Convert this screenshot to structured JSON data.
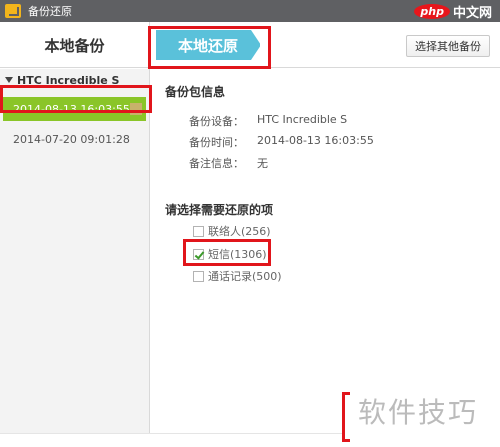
{
  "window": {
    "title": "备份还原"
  },
  "brand": {
    "php": "php",
    "cn": "中文网"
  },
  "header": {
    "left_title": "本地备份",
    "active_tab": "本地还原",
    "select_other_button": "选择其他备份"
  },
  "sidebar": {
    "device": "HTC Incredible S",
    "backups": [
      {
        "label": "2014-08-13 16:03:55",
        "selected": true
      },
      {
        "label": "2014-07-20 09:01:28",
        "selected": false
      }
    ]
  },
  "backup_info": {
    "title": "备份包信息",
    "rows": [
      {
        "label": "备份设备：",
        "value": "HTC Incredible S"
      },
      {
        "label": "备份时间：",
        "value": "2014-08-13 16:03:55"
      },
      {
        "label": "备注信息：",
        "value": "无"
      }
    ]
  },
  "restore_options": {
    "title": "请选择需要还原的项",
    "items": [
      {
        "label": "联络人(256)",
        "checked": false
      },
      {
        "label": "短信(1306)",
        "checked": true
      },
      {
        "label": "通话记录(500)",
        "checked": false
      }
    ]
  },
  "watermark": {
    "text": "软件技巧"
  },
  "colors": {
    "titlebar": "#5f6063",
    "tab_active": "#5ac1da",
    "selected_item": "#8ac528",
    "highlight_red": "#e1151b",
    "sidebar_bg": "#f3f3f3"
  }
}
